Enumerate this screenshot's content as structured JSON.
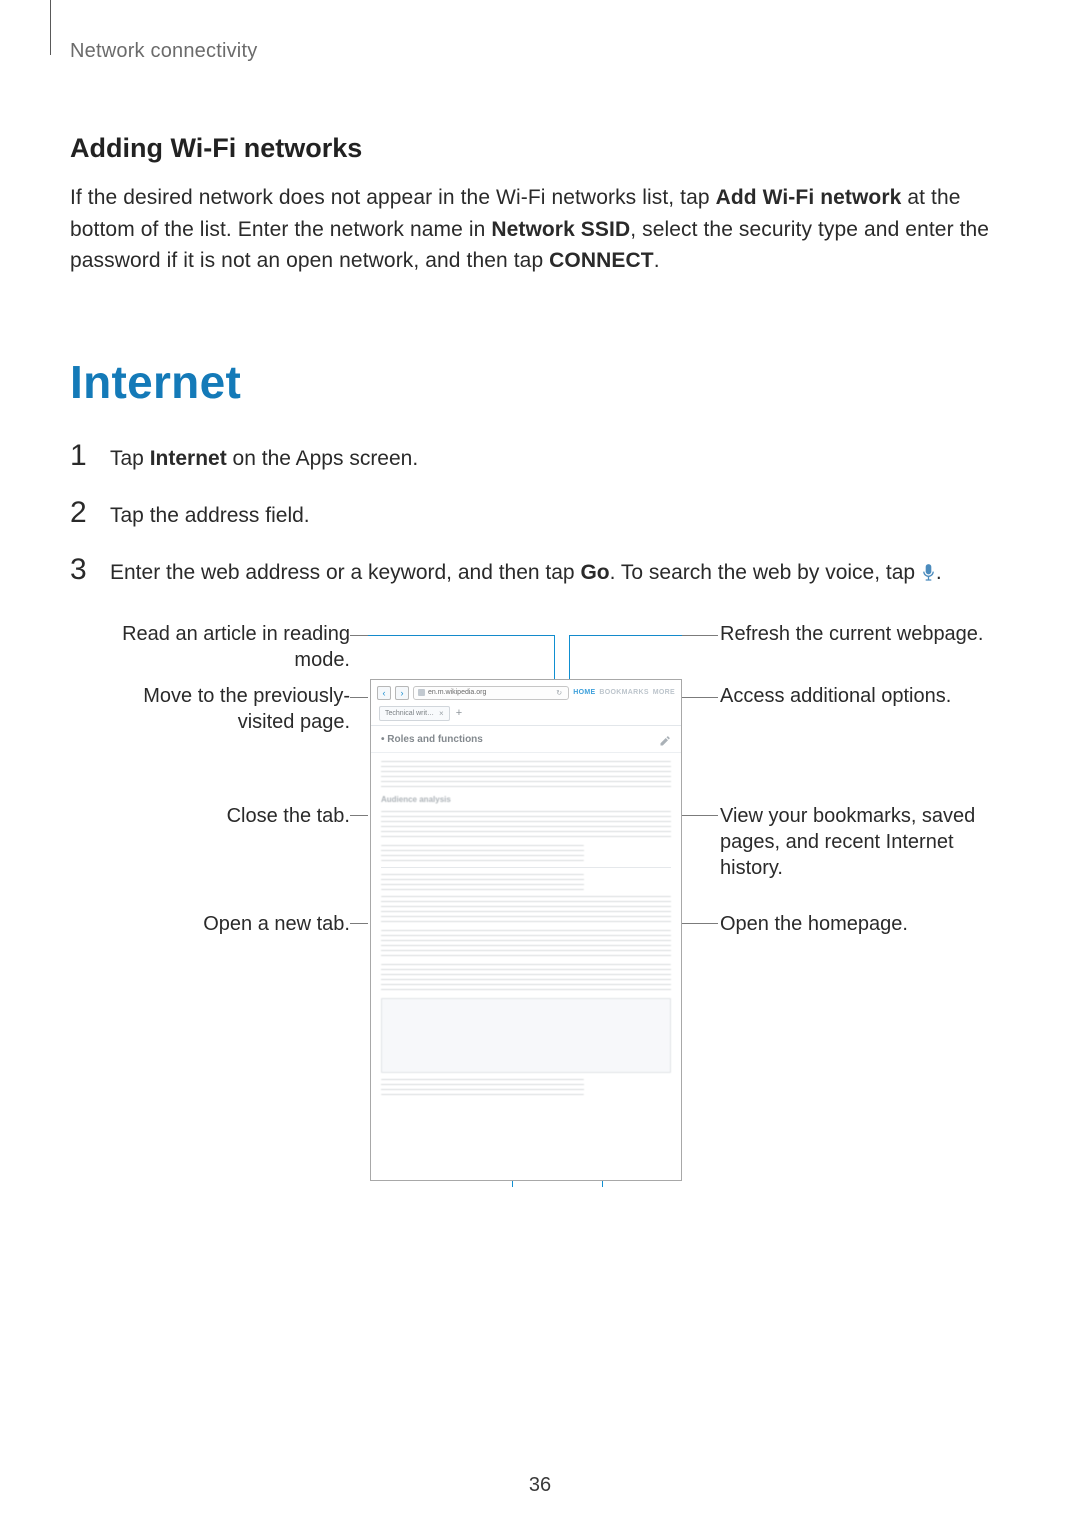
{
  "breadcrumb": "Network connectivity",
  "section1": {
    "heading": "Adding Wi-Fi networks",
    "para_parts": [
      "If the desired network does not appear in the Wi-Fi networks list, tap ",
      "Add Wi-Fi network",
      " at the bottom of the list. Enter the network name in ",
      "Network SSID",
      ", select the security type and enter the password if it is not an open network, and then tap ",
      "CONNECT",
      "."
    ]
  },
  "section2": {
    "heading": "Internet",
    "steps": [
      {
        "n": "1",
        "pre": "Tap ",
        "bold": "Internet",
        "post": " on the Apps screen."
      },
      {
        "n": "2",
        "pre": "Tap the address field.",
        "bold": "",
        "post": ""
      },
      {
        "n": "3",
        "pre": "Enter the web address or a keyword, and then tap ",
        "bold": "Go",
        "post": ". To search the web by voice, tap ",
        "tail_icon": true,
        "tail": "."
      }
    ]
  },
  "callouts": {
    "reading_mode": "Read an article in reading mode.",
    "prev_page": "Move to the previously-visited page.",
    "close_tab": "Close the tab.",
    "new_tab": "Open a new tab.",
    "refresh": "Refresh the current webpage.",
    "more_options": "Access additional options.",
    "bookmarks": "View your bookmarks, saved pages, and recent Internet history.",
    "homepage": "Open the homepage."
  },
  "browser": {
    "url": "en.m.wikipedia.org",
    "tab_label": "Technical writ…",
    "toolbar_home": "HOME",
    "toolbar_bookmarks": "BOOKMARKS",
    "toolbar_more": "MORE",
    "article_title": "Roles and functions"
  },
  "icons": {
    "back": "‹",
    "fwd": "›",
    "close": "×",
    "plus": "+"
  },
  "page_number": "36"
}
